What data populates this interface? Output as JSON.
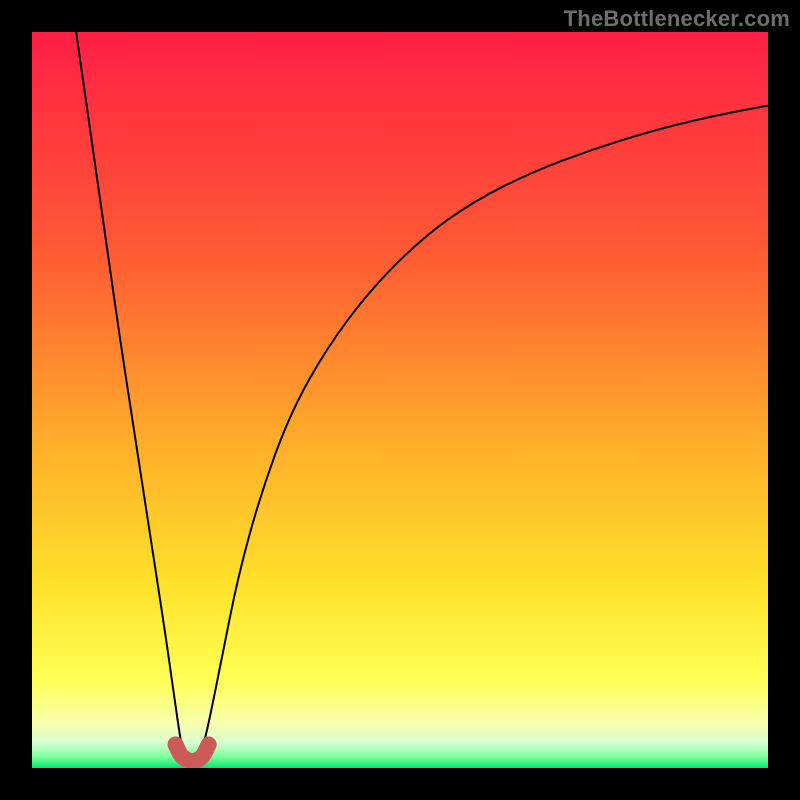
{
  "watermark": {
    "text": "TheBottlenecker.com"
  },
  "chart_data": {
    "type": "line",
    "title": "",
    "xlabel": "",
    "ylabel": "",
    "xlim": [
      0,
      100
    ],
    "ylim": [
      0,
      100
    ],
    "grid": false,
    "gradient_stops": [
      {
        "offset": 0,
        "color": "#ff1f45"
      },
      {
        "offset": 0.3,
        "color": "#ff5a34"
      },
      {
        "offset": 0.55,
        "color": "#ffab2a"
      },
      {
        "offset": 0.75,
        "color": "#ffe12a"
      },
      {
        "offset": 0.88,
        "color": "#ffff55"
      },
      {
        "offset": 0.94,
        "color": "#f8ffb0"
      },
      {
        "offset": 0.965,
        "color": "#d8ffd0"
      },
      {
        "offset": 0.985,
        "color": "#7cff9c"
      },
      {
        "offset": 1.0,
        "color": "#00e86f"
      }
    ],
    "series": [
      {
        "name": "left-branch",
        "color": "#000000",
        "width": 2,
        "x": [
          6,
          8,
          10,
          12,
          14,
          16,
          18,
          19,
          20,
          20.5
        ],
        "y": [
          100,
          86,
          72,
          58,
          45,
          32,
          19,
          12,
          5,
          2
        ]
      },
      {
        "name": "right-branch",
        "color": "#000000",
        "width": 2,
        "x": [
          23,
          24,
          26,
          28,
          31,
          35,
          40,
          46,
          53,
          60,
          68,
          76,
          84,
          92,
          100
        ],
        "y": [
          2,
          6,
          16,
          26,
          37,
          48,
          57,
          65,
          72,
          77,
          81,
          84,
          86.5,
          88.5,
          90
        ]
      },
      {
        "name": "bottom-arc",
        "color": "#cc5a57",
        "width": 16,
        "linecap": "round",
        "x": [
          19.5,
          20.2,
          21,
          21.8,
          22.6,
          23.3,
          24
        ],
        "y": [
          3.2,
          1.7,
          1.1,
          0.9,
          1.1,
          1.7,
          3.2
        ]
      }
    ]
  }
}
